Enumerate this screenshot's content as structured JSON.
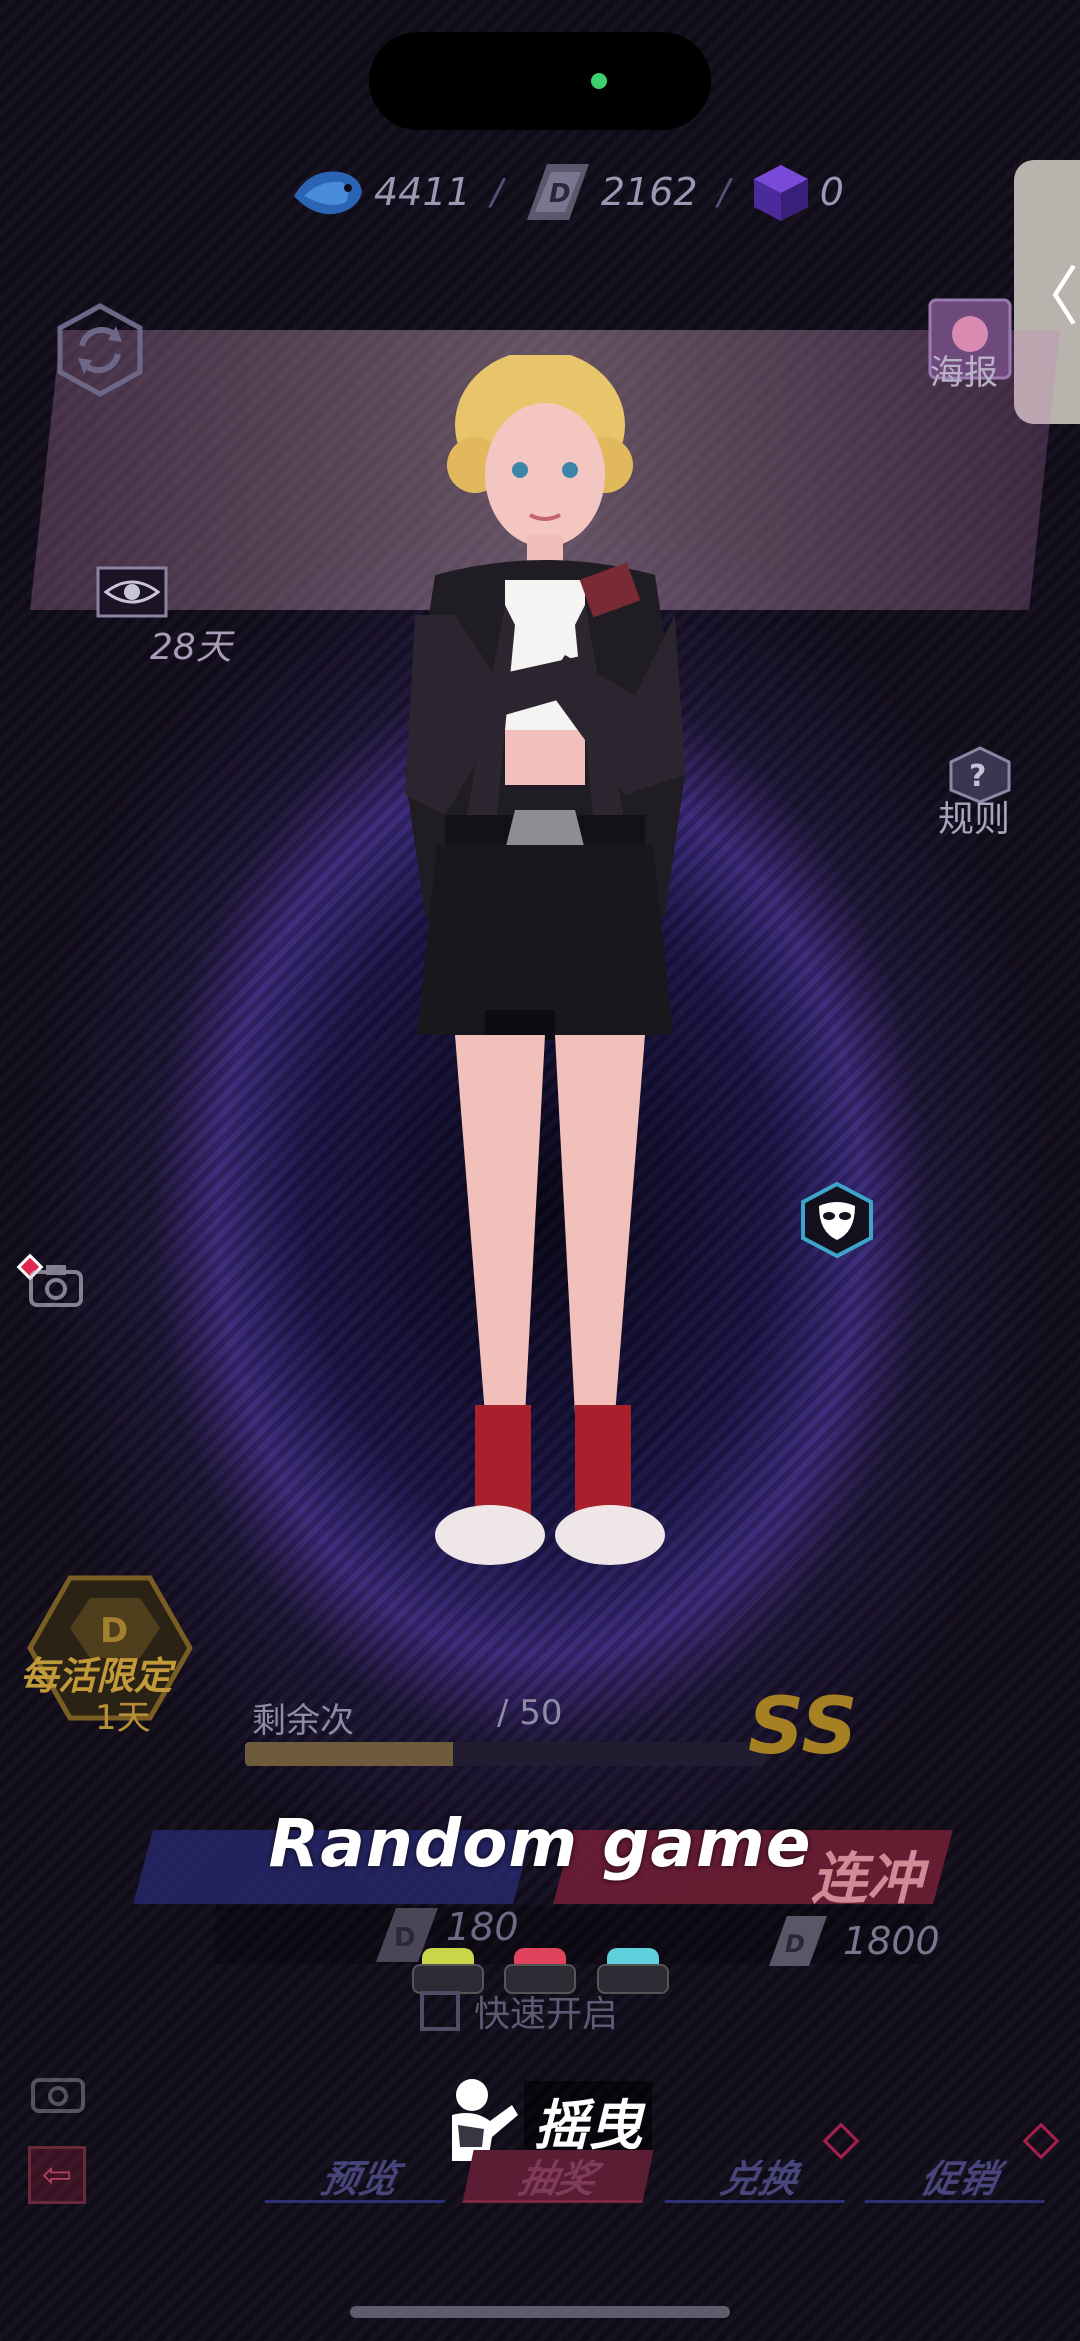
{
  "currency": {
    "gems": "4411",
    "d_coins": "2162",
    "cubes": "0"
  },
  "side_tab": {
    "label": "〈"
  },
  "banner": {
    "poster_label": "海报",
    "duration": "28天",
    "rules_label": "规则"
  },
  "limited_badge": {
    "title": "每活限定",
    "day": "1天"
  },
  "draw": {
    "remain_label": "剩余次",
    "remain_value": "/ 50",
    "progress": 0.4,
    "rank": "SS",
    "ten_label": "连冲",
    "single_price": "180",
    "ten_price": "1800"
  },
  "overlay": {
    "game_title": "Random game",
    "quick_start": "快速开启",
    "shake_label": "摇曳"
  },
  "bottom_nav": {
    "tabs": [
      "预览",
      "抽奖",
      "兑换",
      "促销"
    ],
    "active_index": 1
  },
  "colors": {
    "key_yellow": "#c9d64a",
    "key_red": "#e0445d",
    "key_cyan": "#5ed1dd"
  }
}
